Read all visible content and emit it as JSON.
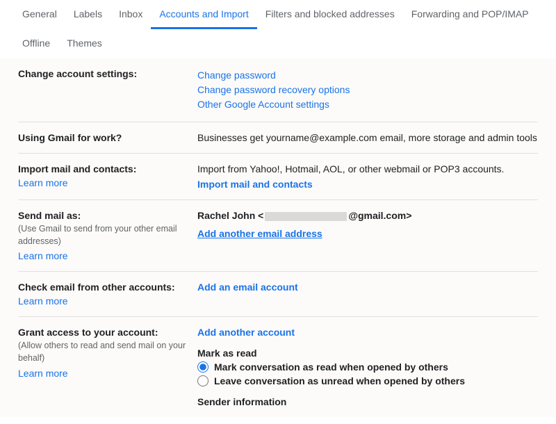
{
  "tabs": {
    "general": "General",
    "labels": "Labels",
    "inbox": "Inbox",
    "accounts": "Accounts and Import",
    "filters": "Filters and blocked addresses",
    "forwarding": "Forwarding and POP/IMAP",
    "offline": "Offline",
    "themes": "Themes"
  },
  "sections": {
    "changeAccount": {
      "title": "Change account settings:",
      "links": {
        "changePassword": "Change password",
        "recovery": "Change password recovery options",
        "other": "Other Google Account settings"
      }
    },
    "gmailWork": {
      "title": "Using Gmail for work?",
      "desc": "Businesses get yourname@example.com email, more storage and admin tools."
    },
    "importMail": {
      "title": "Import mail and contacts:",
      "learnMore": "Learn more",
      "desc": "Import from Yahoo!, Hotmail, AOL, or other webmail or POP3 accounts.",
      "action": "Import mail and contacts"
    },
    "sendMailAs": {
      "title": "Send mail as:",
      "subtitle": "(Use Gmail to send from your other email addresses)",
      "learnMore": "Learn more",
      "namePrefix": "Rachel John <",
      "nameSuffix": "@gmail.com>",
      "addAnother": "Add another email address"
    },
    "checkEmail": {
      "title": "Check email from other accounts:",
      "learnMore": "Learn more",
      "action": "Add an email account"
    },
    "grantAccess": {
      "title": "Grant access to your account:",
      "subtitle": "(Allow others to read and send mail on your behalf)",
      "learnMore": "Learn more",
      "addAnother": "Add another account",
      "markAsRead": "Mark as read",
      "radio1": "Mark conversation as read when opened by others",
      "radio2": "Leave conversation as unread when opened by others",
      "senderInfo": "Sender information"
    }
  }
}
